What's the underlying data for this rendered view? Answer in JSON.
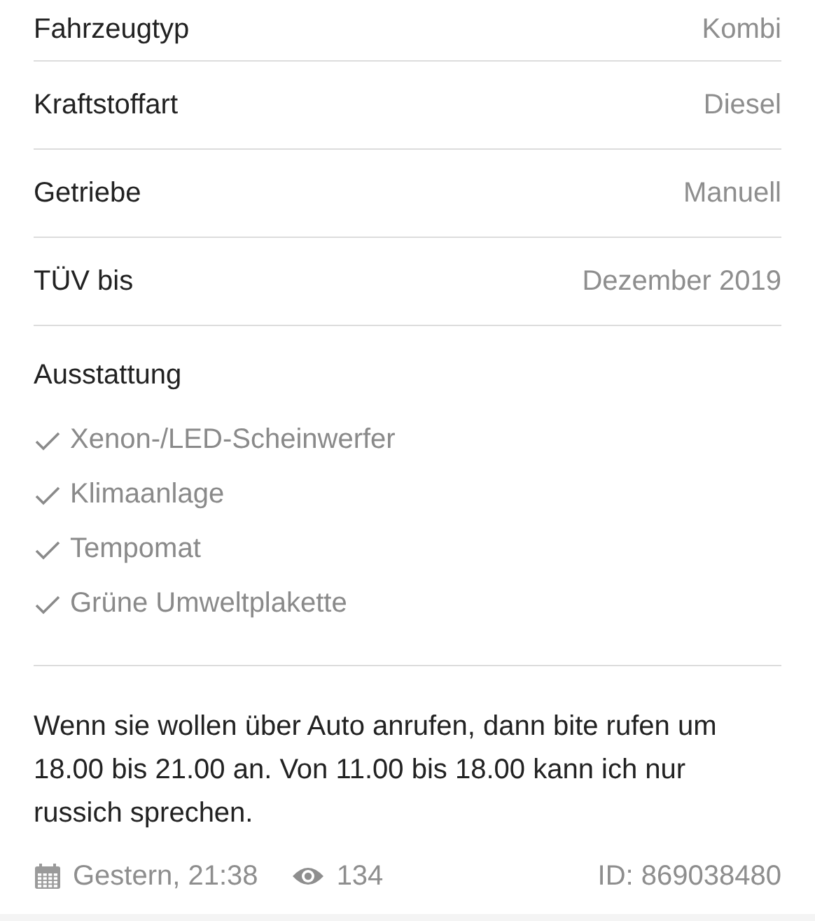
{
  "specs": [
    {
      "label": "Fahrzeugtyp",
      "value": "Kombi"
    },
    {
      "label": "Kraftstoffart",
      "value": "Diesel"
    },
    {
      "label": "Getriebe",
      "value": "Manuell"
    },
    {
      "label": "TÜV bis",
      "value": "Dezember 2019"
    }
  ],
  "equipment": {
    "title": "Ausstattung",
    "items": [
      "Xenon-/LED-Scheinwerfer",
      "Klimaanlage",
      "Tempomat",
      "Grüne Umweltplakette"
    ]
  },
  "description": "Wenn sie wollen über Auto anrufen, dann bite rufen um 18.00 bis 21.00 an. Von 11.00 bis 18.00 kann ich nur russich sprechen.",
  "footer": {
    "date": "Gestern, 21:38",
    "views": "134",
    "id": "ID: 869038480"
  }
}
